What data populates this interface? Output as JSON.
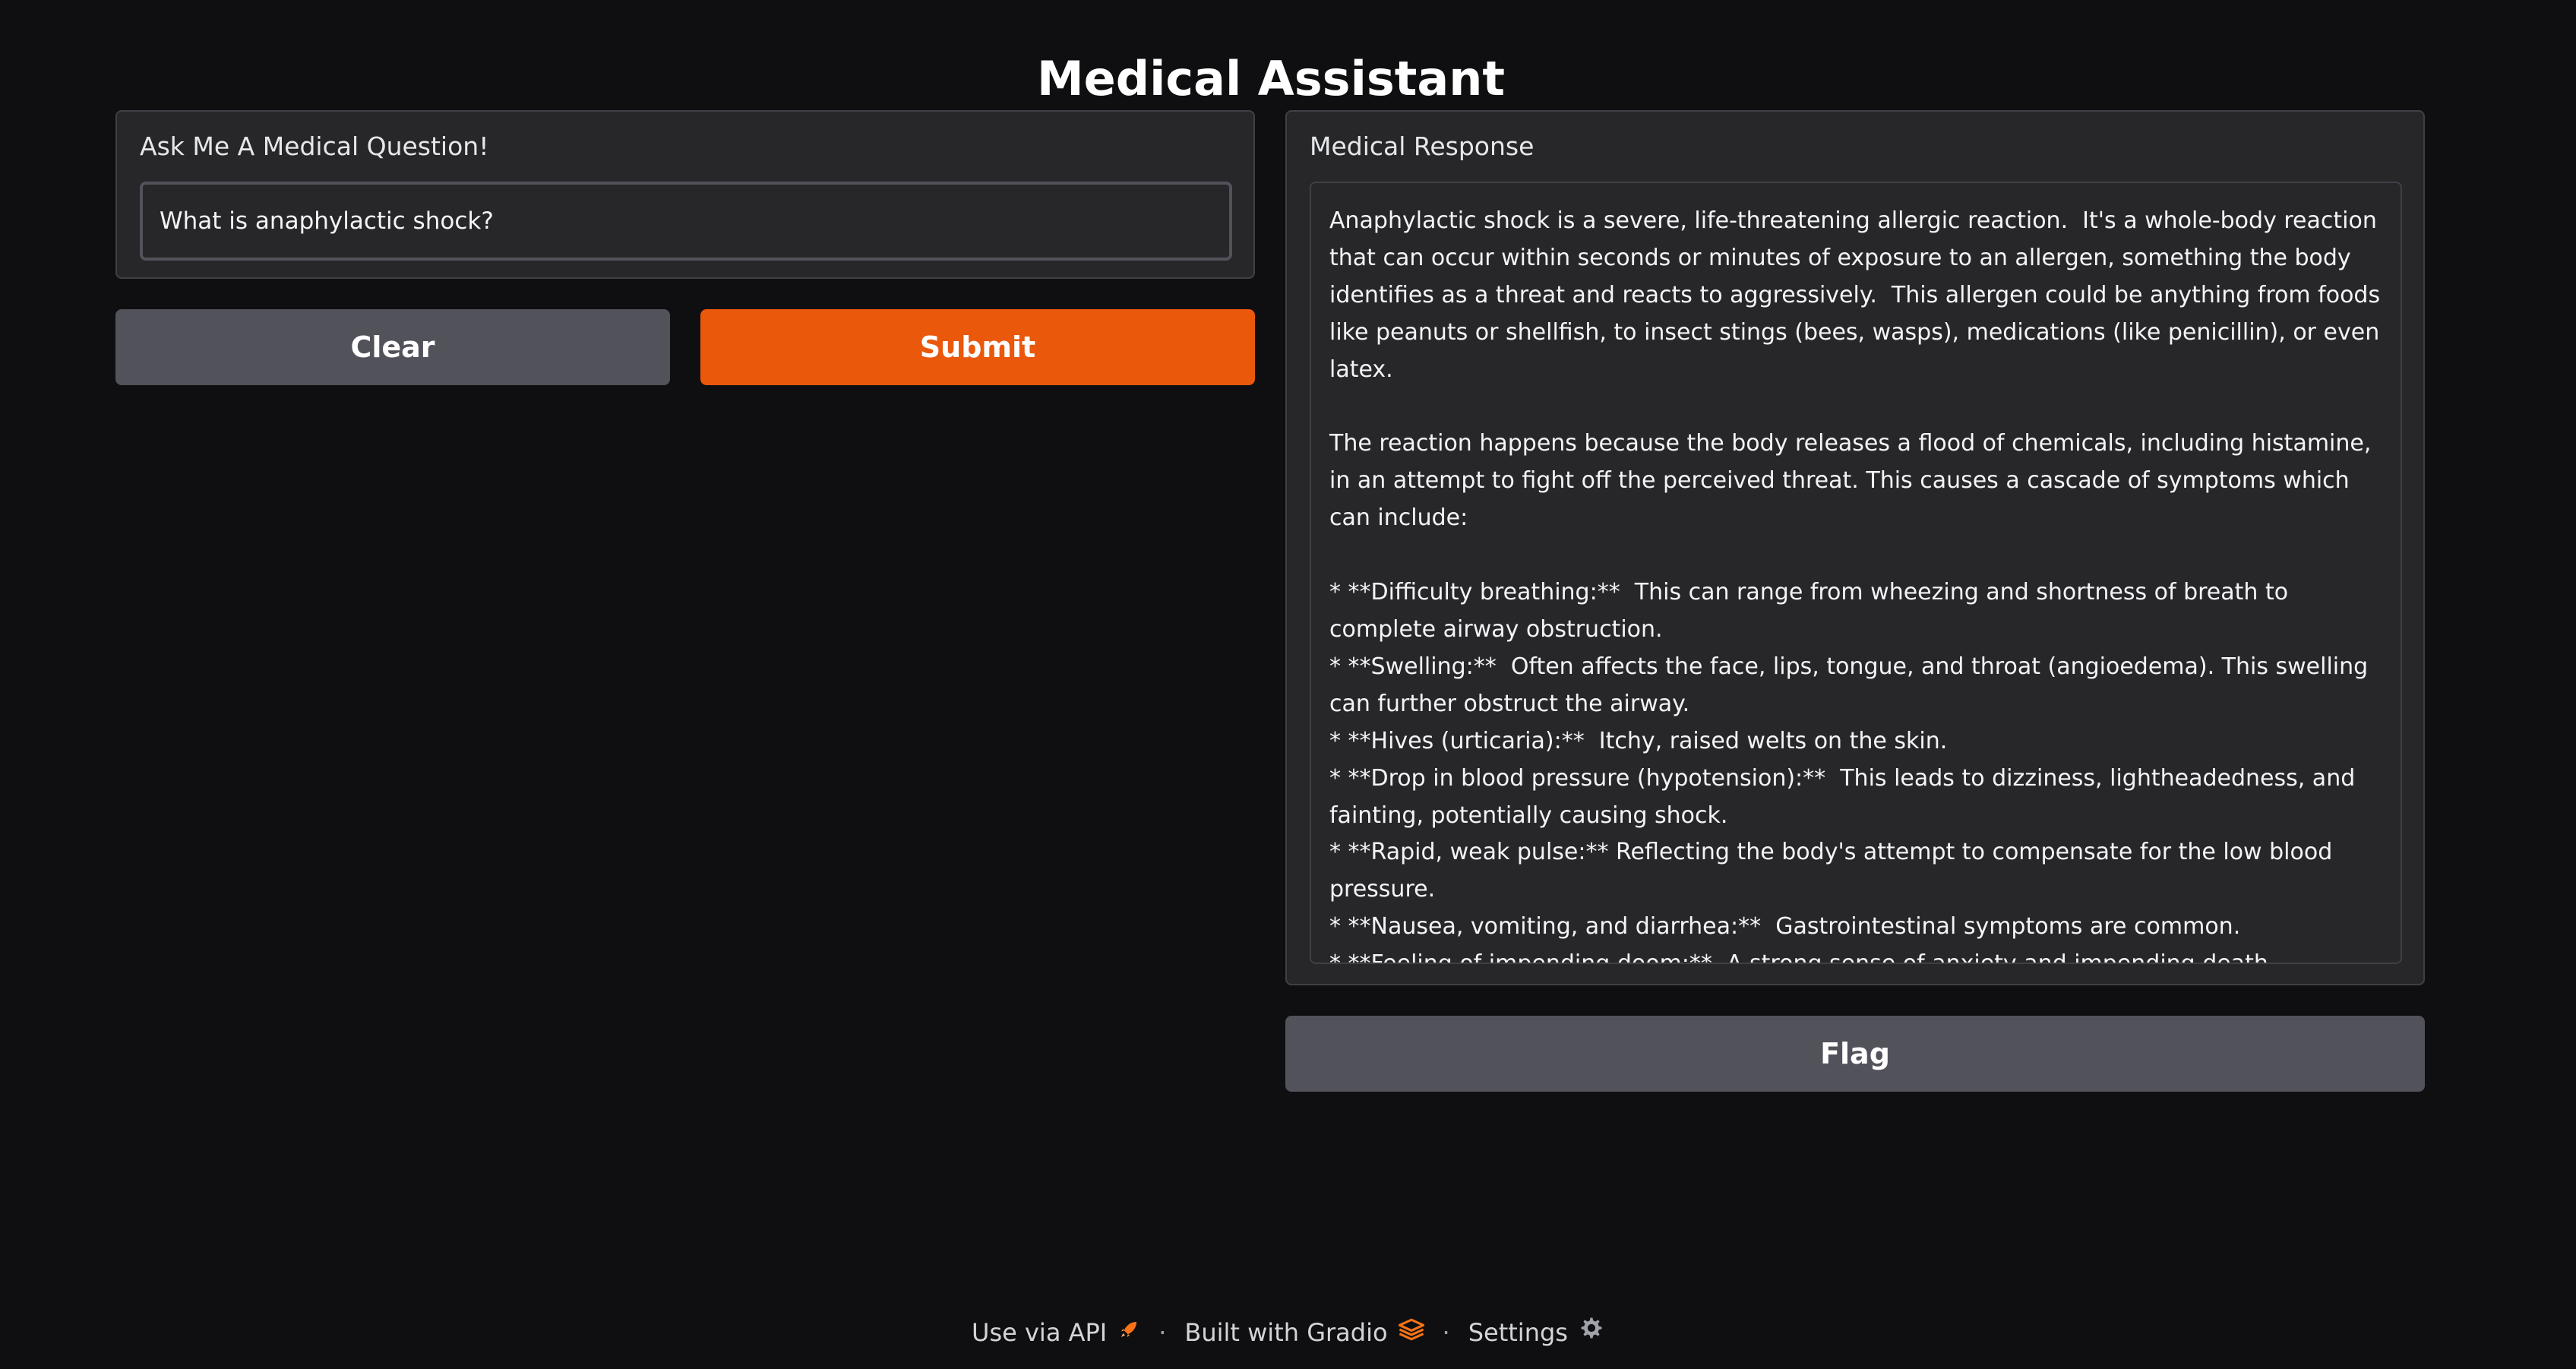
{
  "app": {
    "title": "Medical Assistant"
  },
  "input": {
    "label": "Ask Me A Medical Question!",
    "value": "What is anaphylactic shock?"
  },
  "buttons": {
    "clear_label": "Clear",
    "submit_label": "Submit",
    "flag_label": "Flag"
  },
  "output": {
    "label": "Medical Response",
    "text": "Anaphylactic shock is a severe, life-threatening allergic reaction.  It's a whole-body reaction that can occur within seconds or minutes of exposure to an allergen, something the body identifies as a threat and reacts to aggressively.  This allergen could be anything from foods like peanuts or shellfish, to insect stings (bees, wasps), medications (like penicillin), or even latex.\n\nThe reaction happens because the body releases a flood of chemicals, including histamine, in an attempt to fight off the perceived threat. This causes a cascade of symptoms which can include:\n\n* **Difficulty breathing:**  This can range from wheezing and shortness of breath to complete airway obstruction.\n* **Swelling:**  Often affects the face, lips, tongue, and throat (angioedema). This swelling can further obstruct the airway.\n* **Hives (urticaria):**  Itchy, raised welts on the skin.\n* **Drop in blood pressure (hypotension):**  This leads to dizziness, lightheadedness, and fainting, potentially causing shock.\n* **Rapid, weak pulse:** Reflecting the body's attempt to compensate for the low blood pressure.\n* **Nausea, vomiting, and diarrhea:**  Gastrointestinal symptoms are common.\n* **Feeling of impending doom:**  A strong sense of anxiety and impending death."
  },
  "footer": {
    "api_label": "Use via API",
    "api_icon": "rocket-icon",
    "built_label": "Built with Gradio",
    "built_icon": "gradio-logo-icon",
    "settings_label": "Settings",
    "settings_icon": "gear-icon",
    "separator": "·"
  },
  "colors": {
    "background": "#0f0f11",
    "panel": "#27272a",
    "accent": "#ea580c",
    "secondary_button": "#52525b"
  }
}
